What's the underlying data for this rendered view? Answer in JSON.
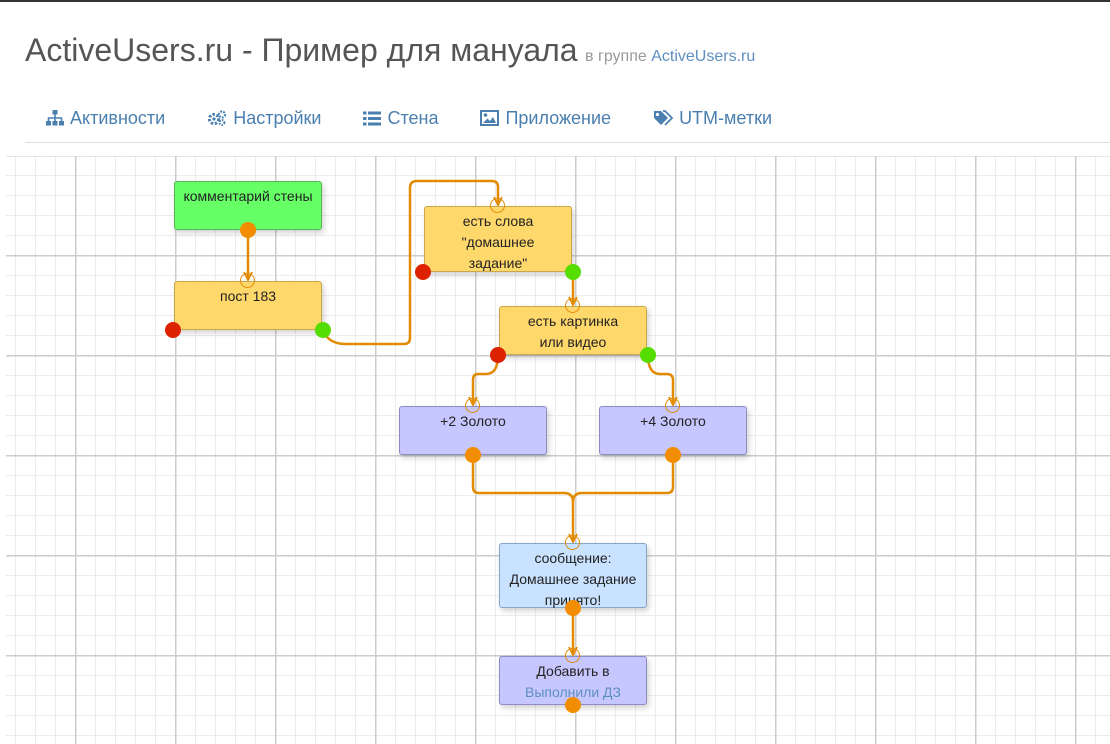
{
  "header": {
    "title": "ActiveUsers.ru - Пример для мануала",
    "group_prefix": "в группе",
    "group_link": "ActiveUsers.ru"
  },
  "tabs": [
    {
      "label": "Активности",
      "icon": "sitemap-icon"
    },
    {
      "label": "Настройки",
      "icon": "gears-icon"
    },
    {
      "label": "Стена",
      "icon": "list-icon"
    },
    {
      "label": "Приложение",
      "icon": "image-icon"
    },
    {
      "label": "UTM-метки",
      "icon": "tags-icon"
    }
  ],
  "colors": {
    "link": "#5e8fbf",
    "wire": "#e28a00",
    "port_success": "#55dd00",
    "port_fail": "#dd2200",
    "node_trigger": "#66ff66",
    "node_condition": "#ffd86b",
    "node_reward": "#c7c7ff",
    "node_message": "#c9e2ff"
  },
  "nodes": {
    "trigger": {
      "lines": [
        "комментарий стены"
      ]
    },
    "post": {
      "lines": [
        "пост 183"
      ]
    },
    "words": {
      "lines": [
        "есть слова",
        "\"домашнее",
        "задание\""
      ]
    },
    "media": {
      "lines": [
        "есть картинка",
        "или видео"
      ]
    },
    "gold2": {
      "lines": [
        "+2 Золото"
      ]
    },
    "gold4": {
      "lines": [
        "+4 Золото"
      ]
    },
    "message": {
      "lines": [
        "сообщение:",
        "Домашнее задание",
        "принято!"
      ]
    },
    "add": {
      "line1": "Добавить в",
      "link": "Выполнили ДЗ"
    }
  }
}
